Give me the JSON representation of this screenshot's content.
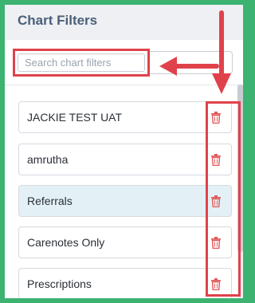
{
  "panel": {
    "title": "Chart Filters"
  },
  "search": {
    "placeholder": "Search chart filters",
    "value": ""
  },
  "filters": [
    {
      "label": "JACKIE TEST UAT",
      "active": false,
      "delete_icon": "trash-icon"
    },
    {
      "label": "amrutha",
      "active": false,
      "delete_icon": "trash-icon"
    },
    {
      "label": "Referrals",
      "active": true,
      "delete_icon": "trash-icon"
    },
    {
      "label": "Carenotes Only",
      "active": false,
      "delete_icon": "trash-icon"
    },
    {
      "label": "Prescriptions",
      "active": false,
      "delete_icon": "trash-icon"
    }
  ],
  "colors": {
    "frame_border": "#3cb371",
    "annotation_red": "#e0424c",
    "active_row": "#e3f1f6",
    "title": "#4a5f78",
    "trash_icon": "#e05a5a"
  }
}
